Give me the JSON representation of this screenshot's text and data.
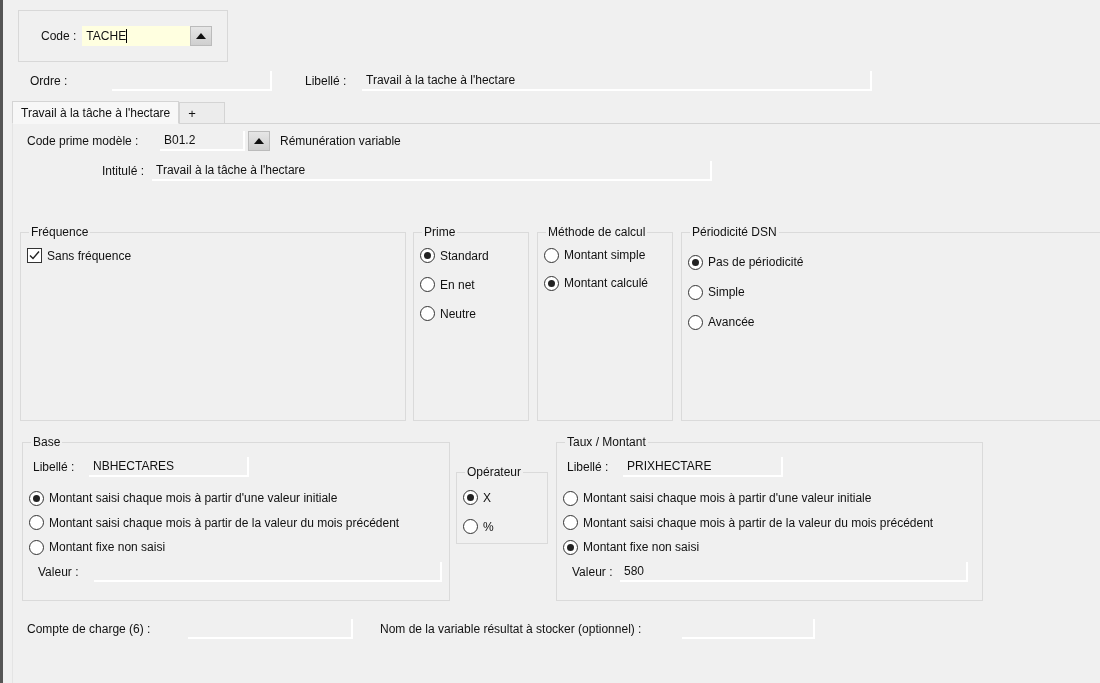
{
  "code": {
    "label": "Code :",
    "value": "TACHE"
  },
  "ordre": {
    "label": "Ordre :"
  },
  "libelle": {
    "label": "Libellé :",
    "value": "Travail à la tache à l'hectare"
  },
  "tabs": [
    {
      "label": "Travail à la tâche à l'hectare",
      "selected": true
    },
    {
      "label": "+",
      "selected": false
    }
  ],
  "code_prime": {
    "label": "Code prime modèle :",
    "value": "B01.2",
    "description": "Rémunération variable"
  },
  "intitule": {
    "label": "Intitulé :",
    "value": "Travail à la tâche à l'hectare"
  },
  "groups": [
    {
      "title": "Fréquence",
      "options": [
        {
          "kind": "checkbox",
          "label": "Sans fréquence",
          "checked": true
        }
      ]
    },
    {
      "title": "Prime",
      "options": [
        {
          "kind": "radio",
          "label": "Standard",
          "selected": true
        },
        {
          "kind": "radio",
          "label": "En net",
          "selected": false
        },
        {
          "kind": "radio",
          "label": "Neutre",
          "selected": false
        }
      ]
    },
    {
      "title": "Méthode de calcul",
      "options": [
        {
          "kind": "radio",
          "label": "Montant simple",
          "selected": false
        },
        {
          "kind": "radio",
          "label": "Montant calculé",
          "selected": true
        }
      ]
    },
    {
      "title": "Périodicité DSN",
      "options": [
        {
          "kind": "radio",
          "label": "Pas de périodicité",
          "selected": true
        },
        {
          "kind": "radio",
          "label": "Simple",
          "selected": false
        },
        {
          "kind": "radio",
          "label": "Avancée",
          "selected": false
        }
      ]
    }
  ],
  "base": {
    "title": "Base",
    "libelle_label": "Libellé :",
    "libelle_value": "NBHECTARES",
    "options": [
      {
        "label": "Montant saisi chaque mois à partir d'une valeur initiale",
        "selected": true
      },
      {
        "label": "Montant saisi chaque mois à partir de la valeur du mois précédent",
        "selected": false
      },
      {
        "label": "Montant fixe non saisi",
        "selected": false
      }
    ],
    "valeur_label": "Valeur :"
  },
  "operateur": {
    "title": "Opérateur",
    "options": [
      {
        "label": "X",
        "selected": true
      },
      {
        "label": "%",
        "selected": false
      }
    ]
  },
  "taux": {
    "title": "Taux / Montant",
    "libelle_label": "Libellé :",
    "libelle_value": "PRIXHECTARE",
    "options": [
      {
        "label": "Montant saisi chaque mois à partir d'une valeur initiale",
        "selected": false
      },
      {
        "label": "Montant saisi chaque mois à partir de la valeur du mois précédent",
        "selected": false
      },
      {
        "label": "Montant fixe non saisi",
        "selected": true
      }
    ],
    "valeur_label": "Valeur :",
    "valeur_value": "580"
  },
  "compte_charge": {
    "label": "Compte de charge (6) :"
  },
  "variable_resultat": {
    "label": "Nom de la variable résultat à stocker (optionnel) :"
  }
}
